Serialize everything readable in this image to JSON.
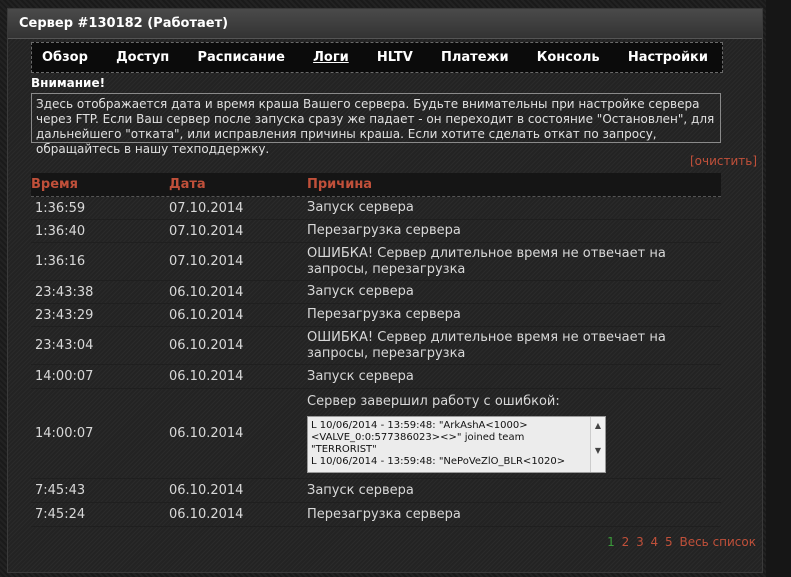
{
  "panel": {
    "title": "Сервер #130182 (Работает)"
  },
  "tabs": [
    {
      "label": "Обзор"
    },
    {
      "label": "Доступ"
    },
    {
      "label": "Расписание"
    },
    {
      "label": "Логи"
    },
    {
      "label": "HLTV"
    },
    {
      "label": "Платежи"
    },
    {
      "label": "Консоль"
    },
    {
      "label": "Настройки"
    }
  ],
  "warning": {
    "title": "Внимание!",
    "text": "Здесь отображается дата и время краша Вашего сервера. Будьте внимательны при настройке сервера через FTP. Если Ваш сервер после запуска сразу же падает - он переходит в состояние \"Остановлен\", для дальнейшего \"отката\", или исправления причины краша. Если хотите сделать откат по запросу, обращайтесь в нашу техподдержку."
  },
  "clear_label": "[очистить]",
  "table": {
    "headers": {
      "time": "Время",
      "date": "Дата",
      "reason": "Причина"
    },
    "rows": [
      {
        "time": "1:36:59",
        "date": "07.10.2014",
        "reason": "Запуск сервера"
      },
      {
        "time": "1:36:40",
        "date": "07.10.2014",
        "reason": "Перезагрузка сервера"
      },
      {
        "time": "1:36:16",
        "date": "07.10.2014",
        "reason": "ОШИБКА! Сервер длительное время не отвечает на запросы, перезагрузка"
      },
      {
        "time": "23:43:38",
        "date": "06.10.2014",
        "reason": "Запуск сервера"
      },
      {
        "time": "23:43:29",
        "date": "06.10.2014",
        "reason": "Перезагрузка сервера"
      },
      {
        "time": "23:43:04",
        "date": "06.10.2014",
        "reason": "ОШИБКА! Сервер длительное время не отвечает на запросы, перезагрузка"
      },
      {
        "time": "14:00:07",
        "date": "06.10.2014",
        "reason": "Запуск сервера"
      },
      {
        "time": "14:00:07",
        "date": "06.10.2014",
        "reason": "Сервер завершил работу с ошибкой:",
        "log": "L 10/06/2014 - 13:59:48: \"ArkAshA<1000><VALVE_0:0:577386023><>\" joined team \"TERRORIST\"\nL 10/06/2014 - 13:59:48: \"NePoVeZlO_BLR<1020>"
      },
      {
        "time": "7:45:43",
        "date": "06.10.2014",
        "reason": "Запуск сервера"
      },
      {
        "time": "7:45:24",
        "date": "06.10.2014",
        "reason": "Перезагрузка сервера"
      }
    ]
  },
  "pager": {
    "pages": [
      "1",
      "2",
      "3",
      "4",
      "5"
    ],
    "all_label": "Весь список"
  },
  "icons": {
    "scroll_up": "▲",
    "scroll_down": "▼"
  },
  "colors": {
    "accent": "#c0503a",
    "current_page": "#3a9a3a"
  }
}
